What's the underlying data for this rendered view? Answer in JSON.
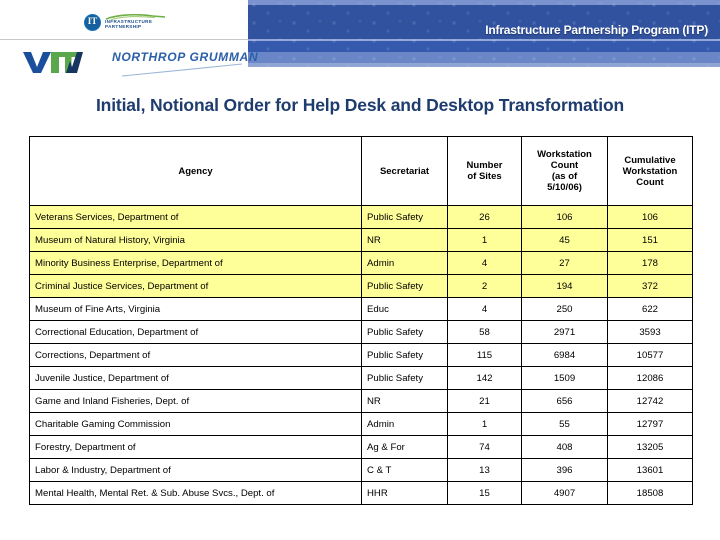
{
  "header": {
    "banner_title": "Infrastructure Partnership Program (ITP)",
    "logos": {
      "ip_mark_letters": "IT",
      "ip_line1": "INFRASTRUCTURE",
      "ip_line2": "PARTNERSHIP",
      "vita_text": "VITA",
      "northrop_text": "NORTHROP GRUMMAN"
    }
  },
  "page_title": "Initial, Notional Order for Help Desk and Desktop Transformation",
  "table": {
    "columns": [
      "Agency",
      "Secretariat",
      "Number of Sites",
      "Workstation Count (as of 5/10/06)",
      "Cumulative Workstation Count"
    ],
    "column_lines": {
      "agency": [
        "Agency"
      ],
      "secretariat": [
        "Secretariat"
      ],
      "sites": [
        "Number",
        "of Sites"
      ],
      "workstation": [
        "Workstation",
        "Count",
        "(as of",
        "5/10/06)"
      ],
      "cumulative": [
        "Cumulative",
        "Workstation",
        "Count"
      ]
    },
    "rows": [
      {
        "agency": "Veterans Services, Department of",
        "secretariat": "Public Safety",
        "sites": "26",
        "workstation_count": "106",
        "cumulative": "106",
        "highlighted": true
      },
      {
        "agency": "Museum of Natural History, Virginia",
        "secretariat": "NR",
        "sites": "1",
        "workstation_count": "45",
        "cumulative": "151",
        "highlighted": true
      },
      {
        "agency": "Minority Business Enterprise, Department of",
        "secretariat": "Admin",
        "sites": "4",
        "workstation_count": "27",
        "cumulative": "178",
        "highlighted": true
      },
      {
        "agency": "Criminal Justice Services, Department of",
        "secretariat": "Public Safety",
        "sites": "2",
        "workstation_count": "194",
        "cumulative": "372",
        "highlighted": true
      },
      {
        "agency": "Museum of Fine Arts, Virginia",
        "secretariat": "Educ",
        "sites": "4",
        "workstation_count": "250",
        "cumulative": "622",
        "highlighted": false
      },
      {
        "agency": "Correctional Education, Department of",
        "secretariat": "Public Safety",
        "sites": "58",
        "workstation_count": "2971",
        "cumulative": "3593",
        "highlighted": false
      },
      {
        "agency": "Corrections, Department of",
        "secretariat": "Public Safety",
        "sites": "115",
        "workstation_count": "6984",
        "cumulative": "10577",
        "highlighted": false
      },
      {
        "agency": "Juvenile Justice, Department of",
        "secretariat": "Public Safety",
        "sites": "142",
        "workstation_count": "1509",
        "cumulative": "12086",
        "highlighted": false
      },
      {
        "agency": "Game and Inland Fisheries, Dept. of",
        "secretariat": "NR",
        "sites": "21",
        "workstation_count": "656",
        "cumulative": "12742",
        "highlighted": false
      },
      {
        "agency": "Charitable Gaming Commission",
        "secretariat": "Admin",
        "sites": "1",
        "workstation_count": "55",
        "cumulative": "12797",
        "highlighted": false
      },
      {
        "agency": "Forestry, Department of",
        "secretariat": "Ag & For",
        "sites": "74",
        "workstation_count": "408",
        "cumulative": "13205",
        "highlighted": false
      },
      {
        "agency": "Labor & Industry, Department of",
        "secretariat": "C & T",
        "sites": "13",
        "workstation_count": "396",
        "cumulative": "13601",
        "highlighted": false
      },
      {
        "agency": "Mental Health, Mental Ret. & Sub. Abuse Svcs., Dept. of",
        "secretariat": "HHR",
        "sites": "15",
        "workstation_count": "4907",
        "cumulative": "18508",
        "highlighted": false
      }
    ]
  },
  "colors": {
    "title_blue": "#1f3c6e",
    "banner_blue": "#31529f",
    "highlight_yellow": "#ffff99",
    "vita_blue": "#1b4f9c",
    "vita_green": "#5aa84b"
  }
}
